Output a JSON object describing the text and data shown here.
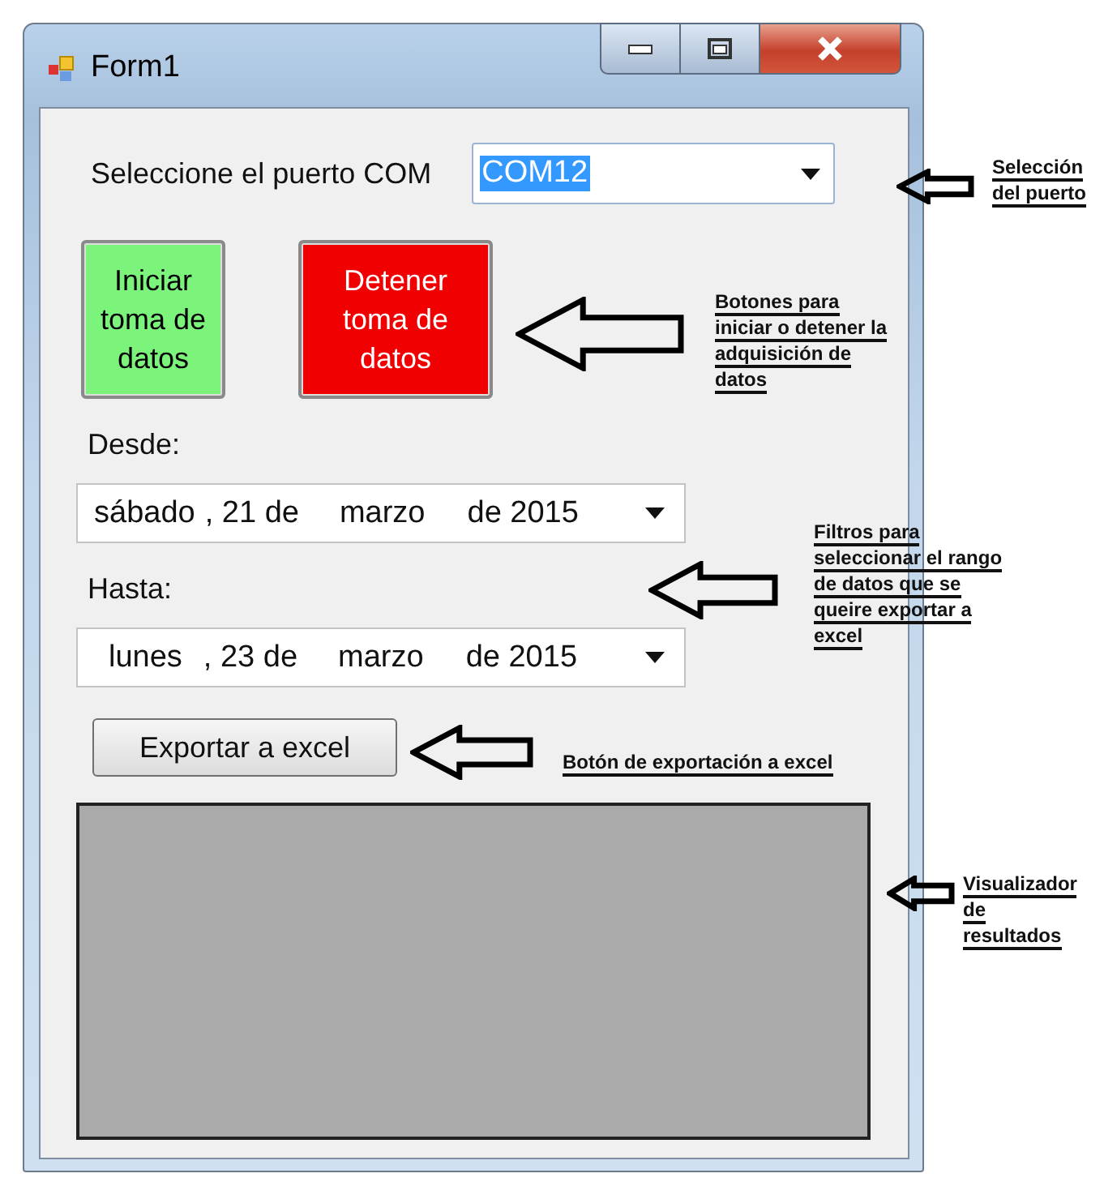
{
  "window": {
    "title": "Form1"
  },
  "port": {
    "label": "Seleccione el puerto COM",
    "value": "COM12"
  },
  "buttons": [
    {
      "label": "Iniciar toma de datos",
      "color": "#7cf47c"
    },
    {
      "label": "Detener toma de datos",
      "color": "#f00000"
    }
  ],
  "from": {
    "label": "Desde:",
    "parts": [
      "sábado",
      ", 21 de",
      "marzo",
      "de 2015"
    ]
  },
  "to": {
    "label": "Hasta:",
    "parts": [
      "lunes",
      ", 23 de",
      "marzo",
      "de 2015"
    ]
  },
  "export_button": {
    "label": "Exportar a excel"
  },
  "annotations": [
    {
      "lines": [
        "Selección",
        "del puerto"
      ]
    },
    {
      "lines": [
        "Botones para",
        "iniciar o detener la",
        "adquisición de",
        "datos"
      ]
    },
    {
      "lines": [
        "Filtros para",
        "seleccionar el rango",
        "de datos que se",
        "queire exportar a",
        "excel"
      ]
    },
    {
      "lines": [
        "Botón de exportación a excel"
      ]
    },
    {
      "lines": [
        "Visualizador",
        "de",
        "resultados"
      ]
    }
  ]
}
